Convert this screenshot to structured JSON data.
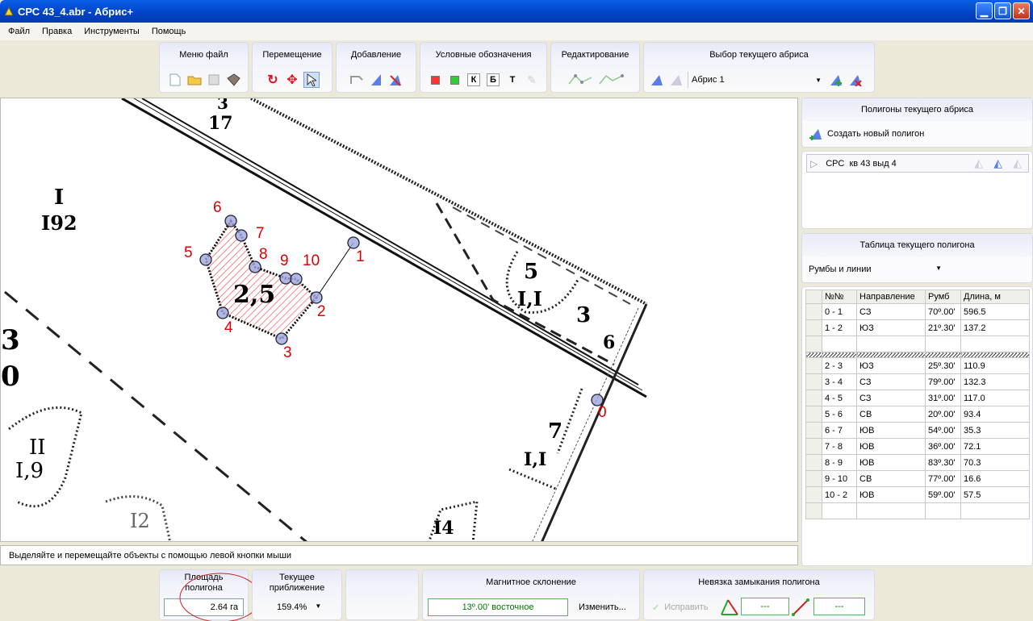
{
  "window": {
    "title": "СРС 43_4.abr - Абрис+",
    "minimize": "▁",
    "restore": "❐",
    "close": "✕"
  },
  "menu": [
    "Файл",
    "Правка",
    "Инструменты",
    "Помощь"
  ],
  "toolbar": {
    "groups": [
      "Меню файл",
      "Перемещение",
      "Добавление",
      "Условные обозначения",
      "Редактирование",
      "Выбор текущего абриса"
    ],
    "letters": [
      "К",
      "Б",
      "Т"
    ],
    "abris_value": "Абрис 1"
  },
  "map": {
    "point_labels": [
      "0",
      "1",
      "2",
      "3",
      "4",
      "5",
      "6",
      "7",
      "8",
      "9",
      "10"
    ],
    "area_label": "2,5",
    "sheet_labels": [
      "3",
      "17",
      "I",
      "I92",
      "5",
      "I,I",
      "3",
      "6",
      "7",
      "I,I",
      "II",
      "I,9",
      "I2",
      "I4",
      "3",
      "0"
    ]
  },
  "status": "Выделяйте и перемещайте объекты с помощью левой кнопки мыши",
  "right": {
    "polygons_title": "Полигоны текущего абриса",
    "create_label": "Создать новый полигон",
    "polygon_item": "СРС  кв 43 выд 4",
    "table_title": "Таблица текущего полигона",
    "table_mode": "Румбы и линии",
    "columns": [
      "№№",
      "Направление",
      "Румб",
      "Длина, м"
    ],
    "rows_a": [
      [
        "0 - 1",
        "СЗ",
        "70º.00'",
        "596.5"
      ],
      [
        "1 - 2",
        "ЮЗ",
        "21º.30'",
        "137.2"
      ]
    ],
    "rows_b": [
      [
        "2 - 3",
        "ЮЗ",
        "25º.30'",
        "110.9"
      ],
      [
        "3 - 4",
        "СЗ",
        "79º.00'",
        "132.3"
      ],
      [
        "4 - 5",
        "СЗ",
        "31º.00'",
        "117.0"
      ],
      [
        "5 - 6",
        "СВ",
        "20º.00'",
        "93.4"
      ],
      [
        "6 - 7",
        "ЮВ",
        "54º.00'",
        "35.3"
      ],
      [
        "7 - 8",
        "ЮВ",
        "36º.00'",
        "72.1"
      ],
      [
        "8 - 9",
        "ЮВ",
        "83º.30'",
        "70.3"
      ],
      [
        "9 - 10",
        "СВ",
        "77º.00'",
        "16.6"
      ],
      [
        "10 - 2",
        "ЮВ",
        "59º.00'",
        "57.5"
      ]
    ]
  },
  "bottom": {
    "area_title": "Площадь полигона",
    "area_value": "2.64 га",
    "zoom_title": "Текущее приближение",
    "zoom_value": "159.4%",
    "mag_title": "Магнитное склонение",
    "mag_value": "13º.00' восточное",
    "mag_change": "Изменить...",
    "closure_title": "Невязка замыкания полигона",
    "fix_label": "Исправить",
    "closure_a": "---",
    "closure_b": "---"
  }
}
